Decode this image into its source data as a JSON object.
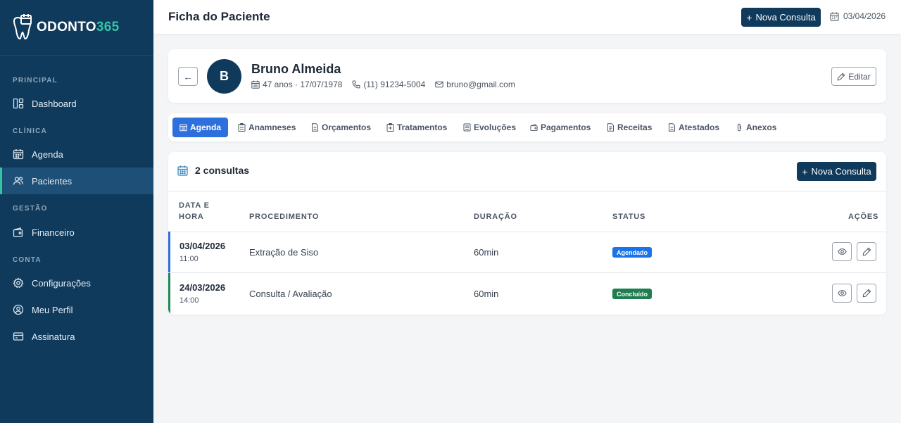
{
  "sidebar": {
    "brand_main": "ODONTO",
    "brand_accent": "365",
    "sections": {
      "principal": "PRINCIPAL",
      "clinica": "CLÍNICA",
      "gestao": "GESTÃO",
      "conta": "CONTA"
    },
    "items": {
      "dashboard": "Dashboard",
      "agenda": "Agenda",
      "pacientes": "Pacientes",
      "financeiro": "Financeiro",
      "configuracoes": "Configurações",
      "perfil": "Meu Perfil",
      "assinatura": "Assinatura"
    },
    "active_item": "Pacientes"
  },
  "header": {
    "title": "Ficha do Paciente",
    "new_button": "Nova Consulta",
    "date": "03/04/2026"
  },
  "patient": {
    "initial": "B",
    "name": "Bruno Almeida",
    "age_birth": "47 anos · 17/07/1978",
    "phone": "(11) 91234-5004",
    "email": "bruno@gmail.com",
    "edit_label": "Editar",
    "back_label": "←"
  },
  "tabs": {
    "agenda": "Agenda",
    "anamneses": "Anamneses",
    "orcamentos": "Orçamentos",
    "tratamentos": "Tratamentos",
    "evolucoes": "Evoluções",
    "pagamentos": "Pagamentos",
    "receitas": "Receitas",
    "atestados": "Atestados",
    "anexos": "Anexos",
    "active": "Agenda"
  },
  "consultas": {
    "count_label": "2 consultas",
    "new_button": "Nova Consulta",
    "columns": {
      "date_line1": "DATA E",
      "date_line2": "HORA",
      "procedure": "PROCEDIMENTO",
      "duration": "DURAÇÃO",
      "status": "STATUS",
      "actions": "AÇÕES"
    },
    "rows": [
      {
        "date": "03/04/2026",
        "time": "11:00",
        "procedure": "Extração de Siso",
        "duration": "60min",
        "status": "Agendado",
        "status_color": "#1a73e8",
        "stripe_color": "#2c6fdd"
      },
      {
        "date": "24/03/2026",
        "time": "14:00",
        "procedure": "Consulta / Avaliação",
        "duration": "60min",
        "status": "Concluído",
        "status_color": "#1e7e4f",
        "stripe_color": "#1e8a56"
      }
    ]
  },
  "colors": {
    "sidebar_bg": "#0f3a5c",
    "accent": "#34c4a4",
    "primary_button": "#0f3a5c",
    "active_tab": "#2c6fdd"
  },
  "icons": {
    "logo": "tooth-calendar-icon",
    "dashboard": "layout-icon",
    "agenda": "calendar-icon",
    "pacientes": "users-icon",
    "financeiro": "wallet-icon",
    "configuracoes": "gear-icon",
    "perfil": "user-circle-icon",
    "assinatura": "card-icon",
    "view": "eye-icon",
    "edit": "pencil-icon"
  }
}
